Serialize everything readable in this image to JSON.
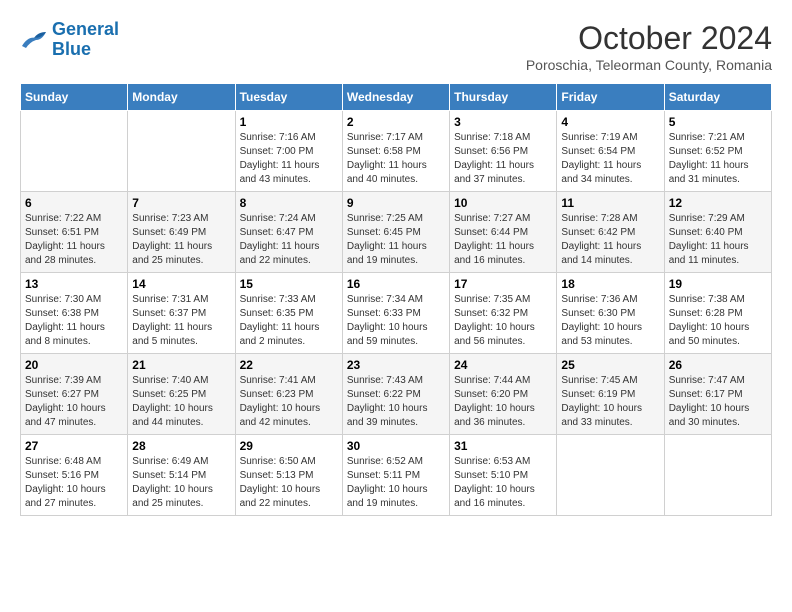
{
  "header": {
    "logo_line1": "General",
    "logo_line2": "Blue",
    "month_title": "October 2024",
    "subtitle": "Poroschia, Teleorman County, Romania"
  },
  "weekdays": [
    "Sunday",
    "Monday",
    "Tuesday",
    "Wednesday",
    "Thursday",
    "Friday",
    "Saturday"
  ],
  "weeks": [
    [
      {
        "day": "",
        "detail": ""
      },
      {
        "day": "",
        "detail": ""
      },
      {
        "day": "1",
        "detail": "Sunrise: 7:16 AM\nSunset: 7:00 PM\nDaylight: 11 hours\nand 43 minutes."
      },
      {
        "day": "2",
        "detail": "Sunrise: 7:17 AM\nSunset: 6:58 PM\nDaylight: 11 hours\nand 40 minutes."
      },
      {
        "day": "3",
        "detail": "Sunrise: 7:18 AM\nSunset: 6:56 PM\nDaylight: 11 hours\nand 37 minutes."
      },
      {
        "day": "4",
        "detail": "Sunrise: 7:19 AM\nSunset: 6:54 PM\nDaylight: 11 hours\nand 34 minutes."
      },
      {
        "day": "5",
        "detail": "Sunrise: 7:21 AM\nSunset: 6:52 PM\nDaylight: 11 hours\nand 31 minutes."
      }
    ],
    [
      {
        "day": "6",
        "detail": "Sunrise: 7:22 AM\nSunset: 6:51 PM\nDaylight: 11 hours\nand 28 minutes."
      },
      {
        "day": "7",
        "detail": "Sunrise: 7:23 AM\nSunset: 6:49 PM\nDaylight: 11 hours\nand 25 minutes."
      },
      {
        "day": "8",
        "detail": "Sunrise: 7:24 AM\nSunset: 6:47 PM\nDaylight: 11 hours\nand 22 minutes."
      },
      {
        "day": "9",
        "detail": "Sunrise: 7:25 AM\nSunset: 6:45 PM\nDaylight: 11 hours\nand 19 minutes."
      },
      {
        "day": "10",
        "detail": "Sunrise: 7:27 AM\nSunset: 6:44 PM\nDaylight: 11 hours\nand 16 minutes."
      },
      {
        "day": "11",
        "detail": "Sunrise: 7:28 AM\nSunset: 6:42 PM\nDaylight: 11 hours\nand 14 minutes."
      },
      {
        "day": "12",
        "detail": "Sunrise: 7:29 AM\nSunset: 6:40 PM\nDaylight: 11 hours\nand 11 minutes."
      }
    ],
    [
      {
        "day": "13",
        "detail": "Sunrise: 7:30 AM\nSunset: 6:38 PM\nDaylight: 11 hours\nand 8 minutes."
      },
      {
        "day": "14",
        "detail": "Sunrise: 7:31 AM\nSunset: 6:37 PM\nDaylight: 11 hours\nand 5 minutes."
      },
      {
        "day": "15",
        "detail": "Sunrise: 7:33 AM\nSunset: 6:35 PM\nDaylight: 11 hours\nand 2 minutes."
      },
      {
        "day": "16",
        "detail": "Sunrise: 7:34 AM\nSunset: 6:33 PM\nDaylight: 10 hours\nand 59 minutes."
      },
      {
        "day": "17",
        "detail": "Sunrise: 7:35 AM\nSunset: 6:32 PM\nDaylight: 10 hours\nand 56 minutes."
      },
      {
        "day": "18",
        "detail": "Sunrise: 7:36 AM\nSunset: 6:30 PM\nDaylight: 10 hours\nand 53 minutes."
      },
      {
        "day": "19",
        "detail": "Sunrise: 7:38 AM\nSunset: 6:28 PM\nDaylight: 10 hours\nand 50 minutes."
      }
    ],
    [
      {
        "day": "20",
        "detail": "Sunrise: 7:39 AM\nSunset: 6:27 PM\nDaylight: 10 hours\nand 47 minutes."
      },
      {
        "day": "21",
        "detail": "Sunrise: 7:40 AM\nSunset: 6:25 PM\nDaylight: 10 hours\nand 44 minutes."
      },
      {
        "day": "22",
        "detail": "Sunrise: 7:41 AM\nSunset: 6:23 PM\nDaylight: 10 hours\nand 42 minutes."
      },
      {
        "day": "23",
        "detail": "Sunrise: 7:43 AM\nSunset: 6:22 PM\nDaylight: 10 hours\nand 39 minutes."
      },
      {
        "day": "24",
        "detail": "Sunrise: 7:44 AM\nSunset: 6:20 PM\nDaylight: 10 hours\nand 36 minutes."
      },
      {
        "day": "25",
        "detail": "Sunrise: 7:45 AM\nSunset: 6:19 PM\nDaylight: 10 hours\nand 33 minutes."
      },
      {
        "day": "26",
        "detail": "Sunrise: 7:47 AM\nSunset: 6:17 PM\nDaylight: 10 hours\nand 30 minutes."
      }
    ],
    [
      {
        "day": "27",
        "detail": "Sunrise: 6:48 AM\nSunset: 5:16 PM\nDaylight: 10 hours\nand 27 minutes."
      },
      {
        "day": "28",
        "detail": "Sunrise: 6:49 AM\nSunset: 5:14 PM\nDaylight: 10 hours\nand 25 minutes."
      },
      {
        "day": "29",
        "detail": "Sunrise: 6:50 AM\nSunset: 5:13 PM\nDaylight: 10 hours\nand 22 minutes."
      },
      {
        "day": "30",
        "detail": "Sunrise: 6:52 AM\nSunset: 5:11 PM\nDaylight: 10 hours\nand 19 minutes."
      },
      {
        "day": "31",
        "detail": "Sunrise: 6:53 AM\nSunset: 5:10 PM\nDaylight: 10 hours\nand 16 minutes."
      },
      {
        "day": "",
        "detail": ""
      },
      {
        "day": "",
        "detail": ""
      }
    ]
  ]
}
